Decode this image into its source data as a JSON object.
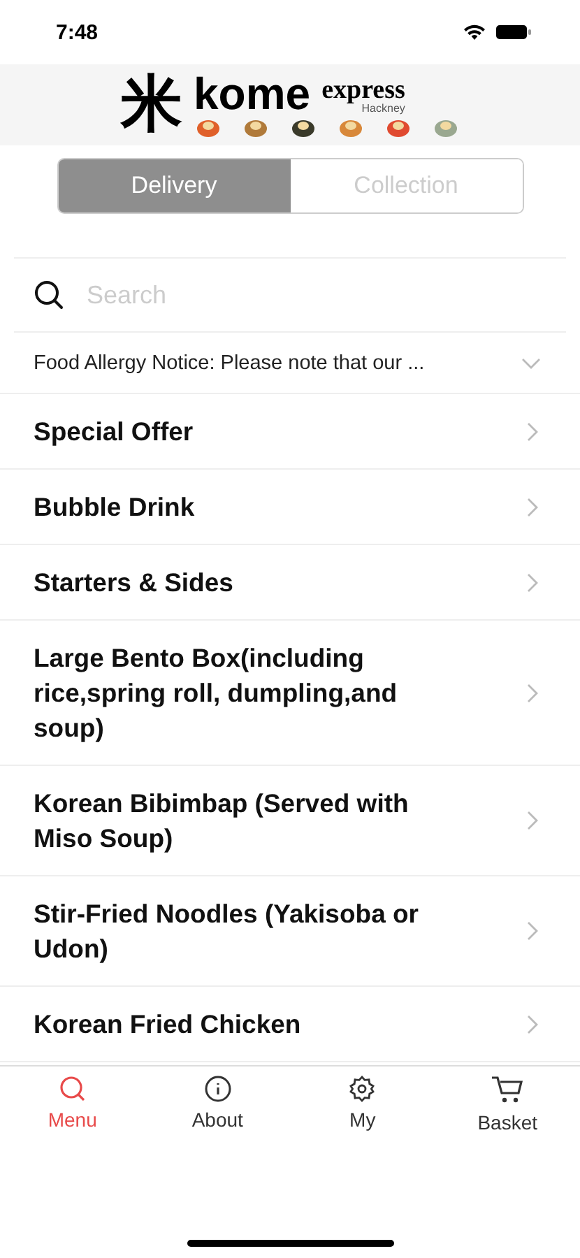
{
  "status_bar": {
    "time": "7:48"
  },
  "logo": {
    "kanji": "米",
    "name": "kome",
    "tagline": "express",
    "location": "Hackney"
  },
  "order_modes": [
    {
      "label": "Delivery",
      "selected": true
    },
    {
      "label": "Collection",
      "selected": false
    }
  ],
  "search": {
    "placeholder": "Search"
  },
  "notice": {
    "text": "Food Allergy Notice: Please note that our ...",
    "expanded": false
  },
  "categories": [
    {
      "label": "Special Offer"
    },
    {
      "label": "Bubble Drink"
    },
    {
      "label": "Starters & Sides"
    },
    {
      "label": "Large Bento Box(including rice,spring roll, dumpling,and soup)"
    },
    {
      "label": "Korean Bibimbap (Served with Miso Soup)"
    },
    {
      "label": "Stir-Fried  Noodles (Yakisoba or Udon)"
    },
    {
      "label": "Korean Fried Chicken"
    }
  ],
  "tab_bar": [
    {
      "label": "Menu",
      "kind": "search",
      "selected": true
    },
    {
      "label": "About",
      "kind": "info",
      "selected": false
    },
    {
      "label": "My",
      "kind": "gear",
      "selected": false
    },
    {
      "label": "Basket",
      "kind": "cart",
      "selected": false
    }
  ]
}
